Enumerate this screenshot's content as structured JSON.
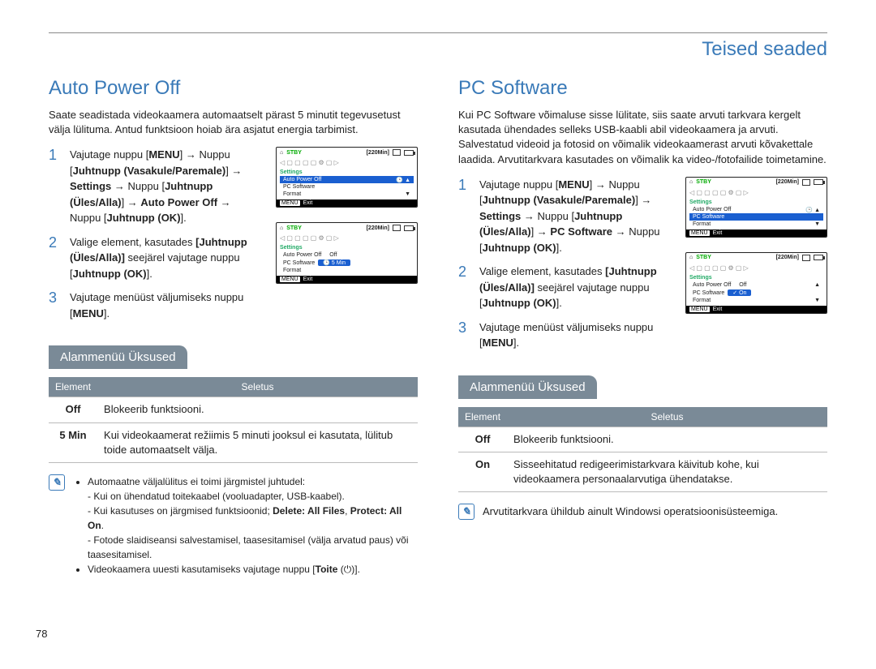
{
  "page_title": "Teised seaded",
  "page_number": "78",
  "left": {
    "heading": "Auto Power Off",
    "intro": "Saate seadistada videokaamera automaatselt pärast 5 minutit tegevusetust välja lülituma. Antud funktsioon hoiab ära asjatut energia tarbimist.",
    "step1_num": "1",
    "step1_a": "Vajutage nuppu [",
    "step1_menu": "MENU",
    "step1_b": "] → Nuppu [",
    "step1_ctrl1": "Juhtnupp (Vasakule/Paremale)",
    "step1_c": "] → ",
    "step1_settings": "Settings",
    "step1_d": " → Nuppu [",
    "step1_ctrl2": "Juhtnupp (Üles/Alla)",
    "step1_e": "] → ",
    "step1_apo": "Auto Power Off",
    "step1_f": " → Nuppu [",
    "step1_ok": "Juhtnupp (OK)",
    "step1_g": "].",
    "step2_num": "2",
    "step2": "Valige element, kasutades ",
    "step2_ctrl": "Juhtnupp (Üles/Alla)",
    "step2_b": " seejärel vajutage nuppu [",
    "step2_ok": "Juhtnupp (OK)",
    "step2_c": "].",
    "step3_num": "3",
    "step3": "Vajutage menüüst väljumiseks nuppu [",
    "step3_menu": "MENU",
    "step3_b": "].",
    "shot1": {
      "stby": "STBY",
      "time": "[220Min]",
      "settings": "Settings",
      "item1": "Auto Power Off",
      "item2": "PC Software",
      "item3": "Format",
      "exit_label": "MENU",
      "exit": "Exit"
    },
    "shot2": {
      "stby": "STBY",
      "time": "[220Min]",
      "settings": "Settings",
      "item1": "Auto Power Off",
      "opt_off": "Off",
      "item2": "PC Software",
      "opt_5": "5 Min",
      "item3": "Format",
      "exit_label": "MENU",
      "exit": "Exit"
    },
    "sub_label": "Alammenüü Üksused",
    "th_element": "Element",
    "th_desc": "Seletus",
    "r1c1": "Off",
    "r1c2": "Blokeerib funktsiooni.",
    "r2c1": "5 Min",
    "r2c2": "Kui videokaamerat režiimis 5 minuti jooksul ei kasutata, lülitub toide automaatselt välja.",
    "note1": "Automaatne väljalülitus ei toimi järgmistel juhtudel:",
    "note1a": "Kui on ühendatud toitekaabel (vooluadapter, USB-kaabel).",
    "note1b_a": "Kui kasutuses on järgmised funktsioonid; ",
    "note1b_b": "Delete: All Files",
    "note1b_c": ", ",
    "note1b_d": "Protect: All On",
    "note1b_e": ".",
    "note1c": "Fotode slaidiseansi salvestamisel, taasesitamisel (välja arvatud paus) või taasesitamisel.",
    "note2_a": "Videokaamera uuesti kasutamiseks vajutage nuppu [",
    "note2_b": "Toite",
    "note2_c": " (",
    "note2_d": ")]."
  },
  "right": {
    "heading": "PC Software",
    "intro": "Kui PC Software võimaluse sisse lülitate, siis saate arvuti tarkvara kergelt kasutada ühendades selleks USB-kaabli abil videokaamera ja arvuti. Salvestatud videoid ja fotosid on võimalik videokaamerast arvuti kõvakettale laadida. Arvutitarkvara kasutades on võimalik ka video-/fotofailide toimetamine.",
    "step1_num": "1",
    "step1_a": "Vajutage nuppu [",
    "step1_menu": "MENU",
    "step1_b": "] → Nuppu [",
    "step1_ctrl1": "Juhtnupp (Vasakule/Paremale)",
    "step1_c": "] → ",
    "step1_settings": "Settings",
    "step1_d": " → Nuppu [",
    "step1_ctrl2": "Juhtnupp (Üles/Alla)",
    "step1_e": "] → ",
    "step1_pcs": "PC Software",
    "step1_f": " → Nuppu [",
    "step1_ok": "Juhtnupp (OK)",
    "step1_g": "].",
    "step2_num": "2",
    "step2": "Valige element, kasutades ",
    "step2_ctrl": "Juhtnupp (Üles/Alla)",
    "step2_b": " seejärel vajutage nuppu [",
    "step2_ok": "Juhtnupp (OK)",
    "step2_c": "].",
    "step3_num": "3",
    "step3": "Vajutage menüüst väljumiseks nuppu [",
    "step3_menu": "MENU",
    "step3_b": "].",
    "shot1": {
      "stby": "STBY",
      "time": "[220Min]",
      "settings": "Settings",
      "item1": "Auto Power Off",
      "item2": "PC Software",
      "item3": "Format",
      "exit_label": "MENU",
      "exit": "Exit"
    },
    "shot2": {
      "stby": "STBY",
      "time": "[220Min]",
      "settings": "Settings",
      "item1": "Auto Power Off",
      "opt_off": "Off",
      "item2": "PC Software",
      "opt_on": "On",
      "item3": "Format",
      "exit_label": "MENU",
      "exit": "Exit"
    },
    "sub_label": "Alammenüü Üksused",
    "th_element": "Element",
    "th_desc": "Seletus",
    "r1c1": "Off",
    "r1c2": "Blokeerib funktsiooni.",
    "r2c1": "On",
    "r2c2": "Sisseehitatud redigeerimistarkvara käivitub kohe, kui videokaamera personaalarvutiga ühendatakse.",
    "note": "Arvutitarkvara ühildub ainult Windowsi operatsioonisüsteemiga."
  }
}
